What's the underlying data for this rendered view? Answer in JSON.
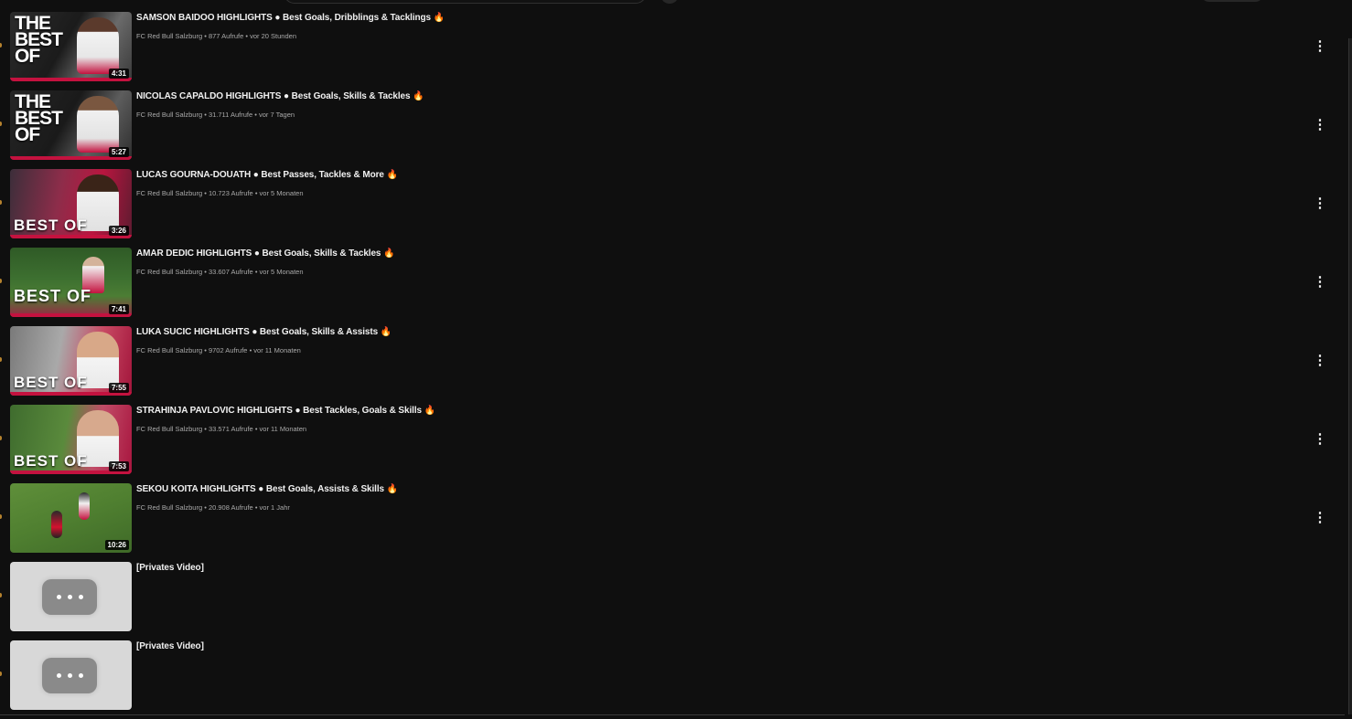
{
  "colors": {
    "background": "#0f0f0f",
    "text_primary": "#f1f1f1",
    "text_secondary": "#aaaaaa",
    "accent_red": "#c4123f"
  },
  "videos": [
    {
      "title": "SAMSON BAIDOO HIGHLIGHTS ● Best Goals, Dribblings & Tacklings 🔥",
      "channel": "FC Red Bull Salzburg",
      "views": "877 Aufrufe",
      "age": "vor 20 Stunden",
      "duration": "4:31",
      "thumb_text": "THE BEST OF",
      "menu_icon": "⋮"
    },
    {
      "title": "NICOLAS CAPALDO HIGHLIGHTS ● Best Goals, Skills & Tackles 🔥",
      "channel": "FC Red Bull Salzburg",
      "views": "31.711 Aufrufe",
      "age": "vor 7 Tagen",
      "duration": "5:27",
      "thumb_text": "THE BEST OF",
      "menu_icon": "⋮"
    },
    {
      "title": "LUCAS GOURNA-DOUATH ● Best Passes, Tackles & More 🔥",
      "channel": "FC Red Bull Salzburg",
      "views": "10.723 Aufrufe",
      "age": "vor 5 Monaten",
      "duration": "3:26",
      "thumb_text": "BEST OF",
      "menu_icon": "⋮"
    },
    {
      "title": "AMAR DEDIC HIGHLIGHTS ● Best Goals, Skills & Tackles 🔥",
      "channel": "FC Red Bull Salzburg",
      "views": "33.607 Aufrufe",
      "age": "vor 5 Monaten",
      "duration": "7:41",
      "thumb_text": "BEST OF",
      "menu_icon": "⋮"
    },
    {
      "title": "LUKA SUCIC HIGHLIGHTS ● Best Goals, Skills & Assists 🔥",
      "channel": "FC Red Bull Salzburg",
      "views": "9702 Aufrufe",
      "age": "vor 11 Monaten",
      "duration": "7:55",
      "thumb_text": "BEST OF",
      "menu_icon": "⋮"
    },
    {
      "title": "STRAHINJA PAVLOVIC HIGHLIGHTS ● Best Tackles, Goals & Skills 🔥",
      "channel": "FC Red Bull Salzburg",
      "views": "33.571 Aufrufe",
      "age": "vor 11 Monaten",
      "duration": "7:53",
      "thumb_text": "BEST OF",
      "menu_icon": "⋮"
    },
    {
      "title": "SEKOU KOITA HIGHLIGHTS ● Best Goals, Assists & Skills 🔥",
      "channel": "FC Red Bull Salzburg",
      "views": "20.908 Aufrufe",
      "age": "vor 1 Jahr",
      "duration": "10:26",
      "thumb_text": "",
      "menu_icon": "⋮"
    }
  ],
  "private_videos": [
    {
      "title": "[Privates Video]"
    },
    {
      "title": "[Privates Video]"
    }
  ]
}
